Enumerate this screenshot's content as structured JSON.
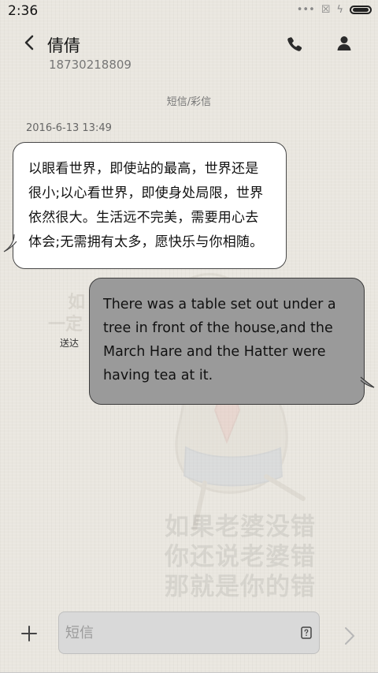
{
  "status_bar": {
    "time": "2:36",
    "icons": [
      "ellipsis-icon",
      "close-box-icon",
      "charging-icon",
      "battery-icon"
    ]
  },
  "header": {
    "contact_name": "倩倩",
    "contact_number": "18730218809",
    "icons": [
      "back-icon",
      "phone-icon",
      "contact-icon"
    ]
  },
  "conversation": {
    "message_type": "短信/彩信",
    "timestamp": "2016-6-13 13:49",
    "incoming_message": {
      "line_1": "以眼看世界，即使站的最高，世界还是",
      "line_2": "很小;以心看世界，即使身处局限，世界",
      "line_3": "依然很大。生活远不完美，需要用心去",
      "line_4": "体会;无需拥有太多，愿快乐与你相随。"
    },
    "outgoing_message": {
      "line_1": "There was a table set out under a",
      "line_2": "tree in front of the house,and the",
      "line_3": "March Hare and the Hatter were",
      "line_4": "having tea at it."
    },
    "delivery_status": "送达"
  },
  "composer": {
    "placeholder": "短信",
    "template_icon": "template-icon",
    "add_icon": "add-icon",
    "send_icon": "send-icon"
  },
  "wallpaper": {
    "caption_line_1": "如果老婆没错",
    "caption_line_2": "你还说老婆错",
    "caption_line_3": "那就是你的错"
  },
  "colors": {
    "background": "#e9e6df",
    "incoming_bubble": "#ffffff",
    "outgoing_bubble": "#9a9a9a",
    "text_primary": "#111111",
    "text_secondary": "#777777"
  }
}
